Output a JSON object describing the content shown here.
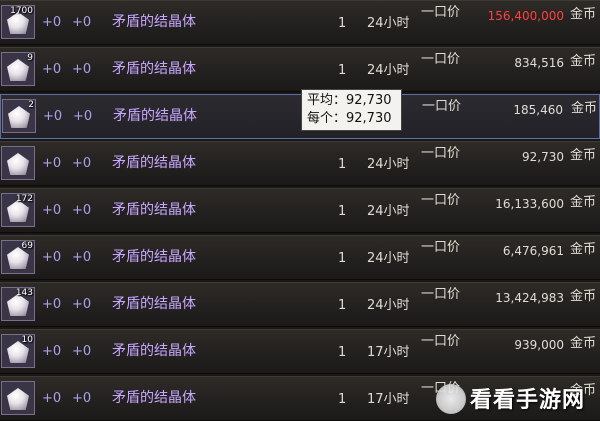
{
  "tooltip": {
    "line1": "平均：92,730",
    "line2": "每个：92,730"
  },
  "columns": {
    "mode_label": "一口价",
    "currency_label": "金币"
  },
  "watermark": {
    "text": "看看手游网"
  },
  "colors": {
    "high_price": "#ff4040",
    "normal_price": "#e0dbd2",
    "name": "#c9a6ff"
  },
  "rows": [
    {
      "qty": "1700",
      "plus1": "+0",
      "plus2": "+0",
      "name": "矛盾的结晶体",
      "count": "1",
      "time": "24小时",
      "price": "156,400,000",
      "price_style": "high"
    },
    {
      "qty": "9",
      "plus1": "+0",
      "plus2": "+0",
      "name": "矛盾的结晶体",
      "count": "1",
      "time": "24小时",
      "price": "834,516",
      "price_style": "normal"
    },
    {
      "qty": "2",
      "plus1": "+0",
      "plus2": "+0",
      "name": "矛盾的结晶体",
      "count": "1",
      "time": "时",
      "price": "185,460",
      "price_style": "normal",
      "selected": true
    },
    {
      "qty": "",
      "plus1": "+0",
      "plus2": "+0",
      "name": "矛盾的结晶体",
      "count": "1",
      "time": "24小时",
      "price": "92,730",
      "price_style": "normal"
    },
    {
      "qty": "172",
      "plus1": "+0",
      "plus2": "+0",
      "name": "矛盾的结晶体",
      "count": "1",
      "time": "24小时",
      "price": "16,133,600",
      "price_style": "normal"
    },
    {
      "qty": "69",
      "plus1": "+0",
      "plus2": "+0",
      "name": "矛盾的结晶体",
      "count": "1",
      "time": "24小时",
      "price": "6,476,961",
      "price_style": "normal"
    },
    {
      "qty": "143",
      "plus1": "+0",
      "plus2": "+0",
      "name": "矛盾的结晶体",
      "count": "1",
      "time": "24小时",
      "price": "13,424,983",
      "price_style": "normal"
    },
    {
      "qty": "10",
      "plus1": "+0",
      "plus2": "+0",
      "name": "矛盾的结晶体",
      "count": "1",
      "time": "17小时",
      "price": "939,000",
      "price_style": "normal"
    },
    {
      "qty": "",
      "plus1": "+0",
      "plus2": "+0",
      "name": "矛盾的结晶体",
      "count": "1",
      "time": "17小时",
      "price": "",
      "price_style": "normal"
    }
  ]
}
